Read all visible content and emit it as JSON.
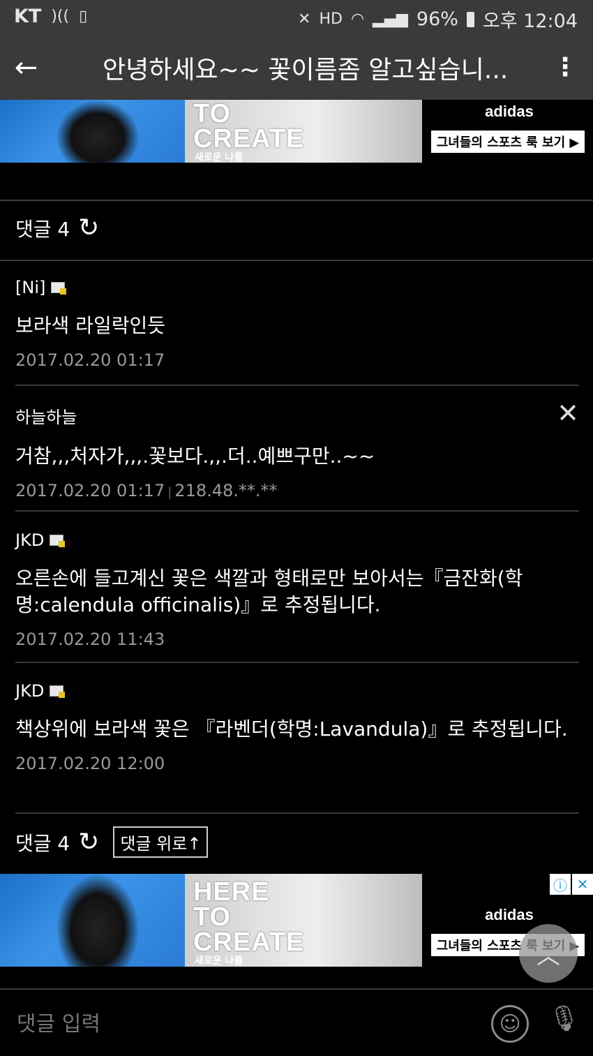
{
  "status_bar": {
    "carrier": "KT",
    "battery": "96%",
    "time": "오후 12:04"
  },
  "app_bar": {
    "title": "안녕하세요~~ 꽃이름좀 알고싶습니..."
  },
  "ads": {
    "top": {
      "headline": "TO\nCREATE",
      "sub": "새로운 나를",
      "brand": "adidas",
      "cta": "그녀들의 스포츠 룩 보기 ▶"
    },
    "bottom": {
      "headline": "HERE\nTO\nCREATE",
      "sub": "새로운 나를",
      "brand": "adidas",
      "cta": "그녀들의 스포츠 룩 보기 ▶"
    }
  },
  "comments_header": {
    "label": "댓글 4",
    "refresh_icon": "↻"
  },
  "comments": [
    {
      "author": "[Ni]",
      "has_memo": true,
      "text": "보라색 라일락인듯",
      "date": "2017.02.20 01:17",
      "ip": ""
    },
    {
      "author": "하늘하늘",
      "has_memo": false,
      "text": "거참,,,처자가,,,.꽃보다.,,.더..예쁘구만..~~",
      "date": "2017.02.20 01:17",
      "ip": "218.48.**.**"
    },
    {
      "author": "JKD",
      "has_memo": true,
      "text": "오른손에 들고계신 꽃은 색깔과 형태로만 보아서는『금잔화(학명:calendula officinalis)』로 추정됩니다.",
      "date": "2017.02.20 11:43",
      "ip": ""
    },
    {
      "author": "JKD",
      "has_memo": true,
      "text": "책상위에 보라색 꽃은 『라벤더(학명:Lavandula)』로 추정됩니다.",
      "date": "2017.02.20 12:00",
      "ip": ""
    }
  ],
  "comments_footer": {
    "label": "댓글 4",
    "up_label": "댓글 위로↑"
  },
  "input": {
    "placeholder": "댓글 입력"
  }
}
